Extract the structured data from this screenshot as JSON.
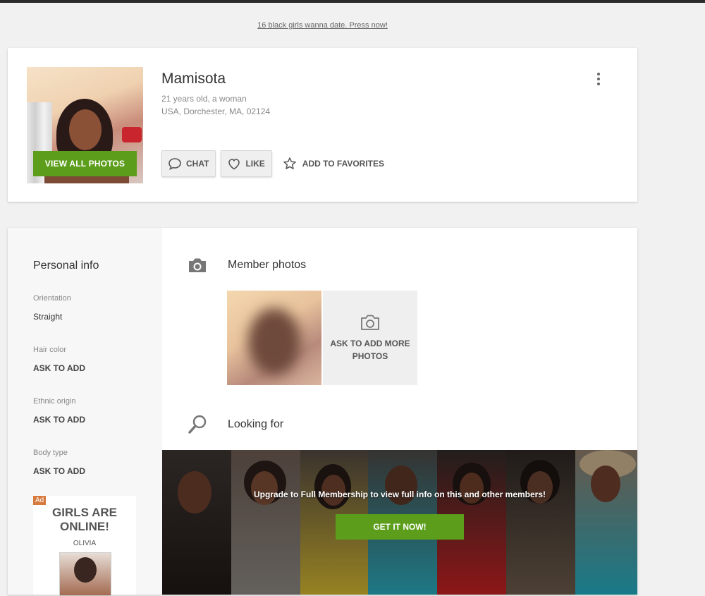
{
  "promo": {
    "link_text": "16 black girls wanna date. Press now!"
  },
  "profile": {
    "name": "Mamisota",
    "age_gender": "21 years old, a woman",
    "location": "USA, Dorchester, MA, 02124",
    "view_all_photos_label": "VIEW ALL PHOTOS",
    "actions": {
      "chat_label": "CHAT",
      "like_label": "LIKE",
      "favorites_label": "ADD TO FAVORITES"
    }
  },
  "personal_info": {
    "title": "Personal info",
    "fields": [
      {
        "label": "Orientation",
        "value": "Straight"
      },
      {
        "label": "Hair color",
        "value": "ASK TO ADD"
      },
      {
        "label": "Ethnic origin",
        "value": "ASK TO ADD"
      },
      {
        "label": "Body type",
        "value": "ASK TO ADD"
      }
    ]
  },
  "ad": {
    "badge": "Ad",
    "title": "GIRLS ARE ONLINE!",
    "subtitle": "OLIVIA"
  },
  "member_photos": {
    "title": "Member photos",
    "ask_more_label": "ASK TO ADD MORE PHOTOS"
  },
  "looking_for": {
    "title": "Looking for",
    "upgrade_text": "Upgrade to Full Membership to view full info on this and other members!",
    "cta_label": "GET IT NOW!"
  },
  "colors": {
    "accent_green": "#5c9e1b",
    "ad_badge": "#d77a3d",
    "background": "#f1f1f1"
  },
  "icons": {
    "chat": "chat-bubble-icon",
    "like": "heart-outline-icon",
    "favorites": "star-outline-icon",
    "more": "kebab-menu-icon",
    "member_photos": "camera-icon",
    "looking_for": "search-icon"
  }
}
